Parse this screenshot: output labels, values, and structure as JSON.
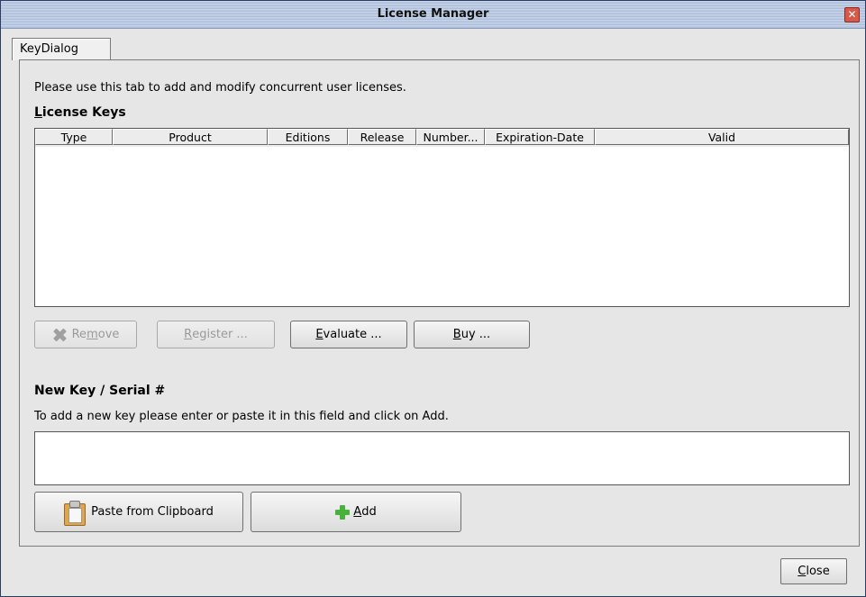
{
  "window": {
    "title": "License Manager"
  },
  "tab": {
    "label": "KeyDialog"
  },
  "intro": "Please use this tab to add and modify concurrent user licenses.",
  "license_keys": {
    "heading_mnemonic": "L",
    "heading_rest": "icense Keys",
    "columns": [
      "Type",
      "Product",
      "Editions",
      "Release",
      "Number...",
      "Expiration-Date",
      "Valid"
    ]
  },
  "buttons": {
    "remove": {
      "mnemonic": "Re",
      "ul": "m",
      "rest": "ove"
    },
    "register": {
      "pre": "",
      "ul": "R",
      "rest": "egister ..."
    },
    "evaluate": {
      "ul": "E",
      "rest": "valuate ..."
    },
    "buy": {
      "ul": "B",
      "rest": "uy ..."
    },
    "paste": "Paste from Clipboard",
    "add": {
      "ul": "A",
      "rest": "dd"
    },
    "close": {
      "ul": "C",
      "rest": "lose"
    }
  },
  "new_key": {
    "heading": "New Key / Serial #",
    "instruction": "To add a new key please enter or paste it in this field and click on Add.",
    "value": ""
  }
}
